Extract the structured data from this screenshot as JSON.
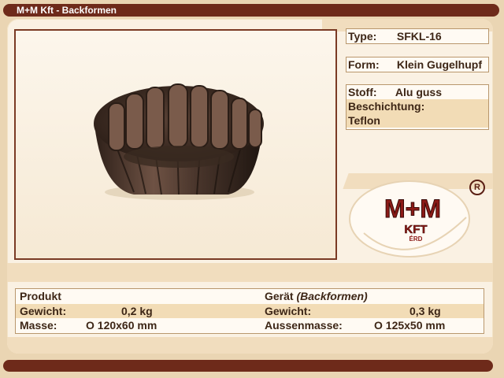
{
  "window": {
    "title": "M+M Kft - Backformen"
  },
  "product_image": {
    "description": ""
  },
  "specs": {
    "type": {
      "label": "Type:",
      "value": "SFKL-16"
    },
    "form": {
      "label": "Form:",
      "value": "Klein Gugelhupf"
    },
    "stoff": {
      "label": "Stoff:",
      "value": "Alu guss"
    },
    "beschichtung": {
      "label": "Beschichtung:",
      "value": "Teflon"
    }
  },
  "logo": {
    "main": "M+M",
    "sub": "KFT",
    "city": "ÉRD",
    "registered": "R"
  },
  "table": {
    "left_header": "Produkt",
    "right_header": "Gerät",
    "right_header_note": "(Backformen)",
    "weight_label_left": "Gewicht:",
    "weight_value_left": "0,2 kg",
    "weight_label_right": "Gewicht:",
    "weight_value_right": "0,3 kg",
    "size_label_left": "Masse:",
    "size_value_left": "O 120x60 mm",
    "size_label_right": "Aussenmasse:",
    "size_value_right": "O 125x50 mm"
  },
  "colors": {
    "bar": "#6e2a1a",
    "background": "#ead5b3",
    "panel": "#faf1e3",
    "row_alt": "#f2dcb6",
    "logo_red": "#8b1a16"
  }
}
